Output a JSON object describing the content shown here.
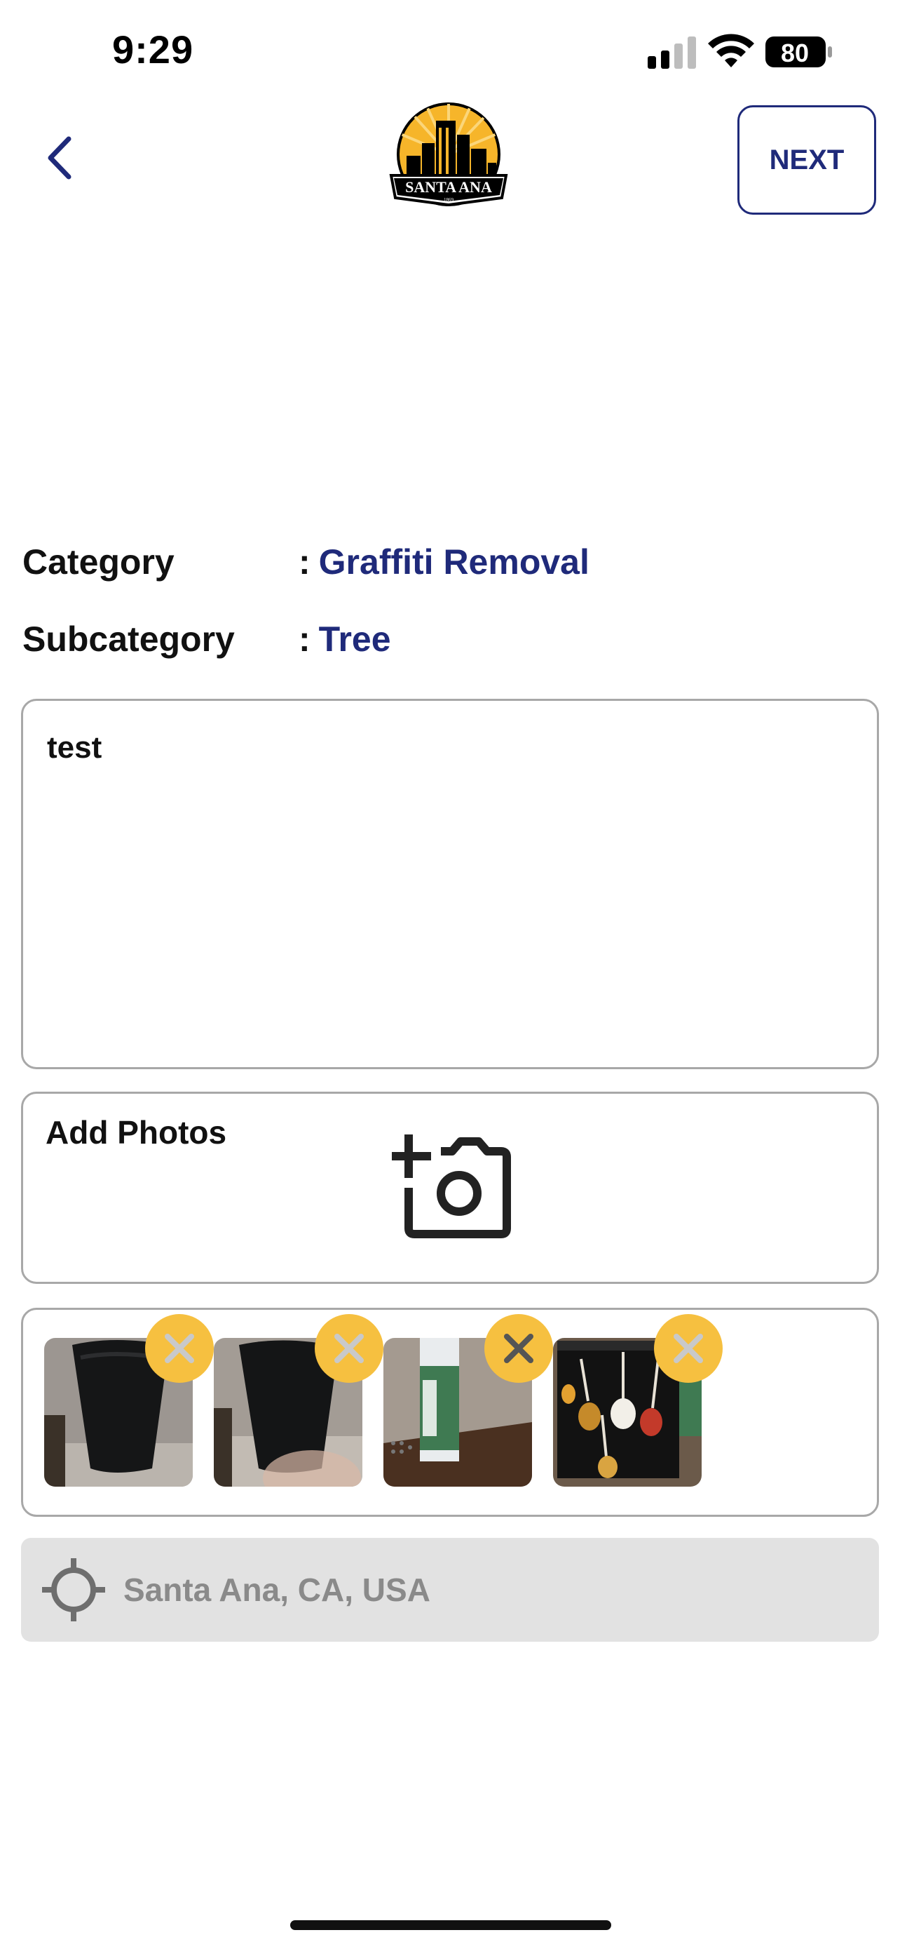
{
  "status_bar": {
    "time": "9:29",
    "battery_level": "80"
  },
  "header": {
    "back_icon": "chevron-left-icon",
    "logo_text": "SANTA ANA",
    "logo_year": "1869",
    "next_label": "NEXT"
  },
  "details": {
    "category_label": "Category",
    "category_value": "Graffiti Removal",
    "subcategory_label": "Subcategory",
    "subcategory_value": "Tree",
    "separator": ":"
  },
  "description": {
    "value": "test"
  },
  "photos": {
    "label": "Add Photos",
    "icon": "add-camera-icon",
    "thumbnails": [
      {
        "subject": "black-cup"
      },
      {
        "subject": "black-cup"
      },
      {
        "subject": "spray-bottle"
      },
      {
        "subject": "guitar-mug"
      }
    ],
    "remove_icon": "close-icon"
  },
  "location": {
    "icon": "crosshair-icon",
    "value": "Santa Ana, CA, USA"
  },
  "colors": {
    "brand_blue": "#1f2a7a",
    "accent_yellow": "#f6c040",
    "border_gray": "#a8a8a8",
    "location_bg": "#e2e2e2"
  }
}
